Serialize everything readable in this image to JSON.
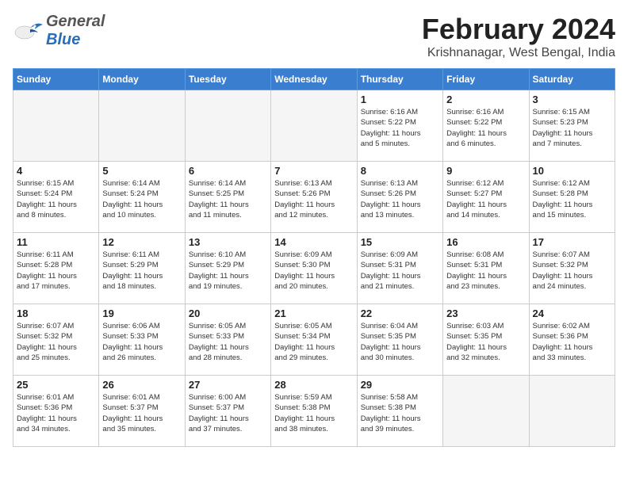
{
  "header": {
    "logo_general": "General",
    "logo_blue": "Blue",
    "month_title": "February 2024",
    "location": "Krishnanagar, West Bengal, India"
  },
  "weekdays": [
    "Sunday",
    "Monday",
    "Tuesday",
    "Wednesday",
    "Thursday",
    "Friday",
    "Saturday"
  ],
  "weeks": [
    [
      {
        "day": "",
        "info": ""
      },
      {
        "day": "",
        "info": ""
      },
      {
        "day": "",
        "info": ""
      },
      {
        "day": "",
        "info": ""
      },
      {
        "day": "1",
        "info": "Sunrise: 6:16 AM\nSunset: 5:22 PM\nDaylight: 11 hours\nand 5 minutes."
      },
      {
        "day": "2",
        "info": "Sunrise: 6:16 AM\nSunset: 5:22 PM\nDaylight: 11 hours\nand 6 minutes."
      },
      {
        "day": "3",
        "info": "Sunrise: 6:15 AM\nSunset: 5:23 PM\nDaylight: 11 hours\nand 7 minutes."
      }
    ],
    [
      {
        "day": "4",
        "info": "Sunrise: 6:15 AM\nSunset: 5:24 PM\nDaylight: 11 hours\nand 8 minutes."
      },
      {
        "day": "5",
        "info": "Sunrise: 6:14 AM\nSunset: 5:24 PM\nDaylight: 11 hours\nand 10 minutes."
      },
      {
        "day": "6",
        "info": "Sunrise: 6:14 AM\nSunset: 5:25 PM\nDaylight: 11 hours\nand 11 minutes."
      },
      {
        "day": "7",
        "info": "Sunrise: 6:13 AM\nSunset: 5:26 PM\nDaylight: 11 hours\nand 12 minutes."
      },
      {
        "day": "8",
        "info": "Sunrise: 6:13 AM\nSunset: 5:26 PM\nDaylight: 11 hours\nand 13 minutes."
      },
      {
        "day": "9",
        "info": "Sunrise: 6:12 AM\nSunset: 5:27 PM\nDaylight: 11 hours\nand 14 minutes."
      },
      {
        "day": "10",
        "info": "Sunrise: 6:12 AM\nSunset: 5:28 PM\nDaylight: 11 hours\nand 15 minutes."
      }
    ],
    [
      {
        "day": "11",
        "info": "Sunrise: 6:11 AM\nSunset: 5:28 PM\nDaylight: 11 hours\nand 17 minutes."
      },
      {
        "day": "12",
        "info": "Sunrise: 6:11 AM\nSunset: 5:29 PM\nDaylight: 11 hours\nand 18 minutes."
      },
      {
        "day": "13",
        "info": "Sunrise: 6:10 AM\nSunset: 5:29 PM\nDaylight: 11 hours\nand 19 minutes."
      },
      {
        "day": "14",
        "info": "Sunrise: 6:09 AM\nSunset: 5:30 PM\nDaylight: 11 hours\nand 20 minutes."
      },
      {
        "day": "15",
        "info": "Sunrise: 6:09 AM\nSunset: 5:31 PM\nDaylight: 11 hours\nand 21 minutes."
      },
      {
        "day": "16",
        "info": "Sunrise: 6:08 AM\nSunset: 5:31 PM\nDaylight: 11 hours\nand 23 minutes."
      },
      {
        "day": "17",
        "info": "Sunrise: 6:07 AM\nSunset: 5:32 PM\nDaylight: 11 hours\nand 24 minutes."
      }
    ],
    [
      {
        "day": "18",
        "info": "Sunrise: 6:07 AM\nSunset: 5:32 PM\nDaylight: 11 hours\nand 25 minutes."
      },
      {
        "day": "19",
        "info": "Sunrise: 6:06 AM\nSunset: 5:33 PM\nDaylight: 11 hours\nand 26 minutes."
      },
      {
        "day": "20",
        "info": "Sunrise: 6:05 AM\nSunset: 5:33 PM\nDaylight: 11 hours\nand 28 minutes."
      },
      {
        "day": "21",
        "info": "Sunrise: 6:05 AM\nSunset: 5:34 PM\nDaylight: 11 hours\nand 29 minutes."
      },
      {
        "day": "22",
        "info": "Sunrise: 6:04 AM\nSunset: 5:35 PM\nDaylight: 11 hours\nand 30 minutes."
      },
      {
        "day": "23",
        "info": "Sunrise: 6:03 AM\nSunset: 5:35 PM\nDaylight: 11 hours\nand 32 minutes."
      },
      {
        "day": "24",
        "info": "Sunrise: 6:02 AM\nSunset: 5:36 PM\nDaylight: 11 hours\nand 33 minutes."
      }
    ],
    [
      {
        "day": "25",
        "info": "Sunrise: 6:01 AM\nSunset: 5:36 PM\nDaylight: 11 hours\nand 34 minutes."
      },
      {
        "day": "26",
        "info": "Sunrise: 6:01 AM\nSunset: 5:37 PM\nDaylight: 11 hours\nand 35 minutes."
      },
      {
        "day": "27",
        "info": "Sunrise: 6:00 AM\nSunset: 5:37 PM\nDaylight: 11 hours\nand 37 minutes."
      },
      {
        "day": "28",
        "info": "Sunrise: 5:59 AM\nSunset: 5:38 PM\nDaylight: 11 hours\nand 38 minutes."
      },
      {
        "day": "29",
        "info": "Sunrise: 5:58 AM\nSunset: 5:38 PM\nDaylight: 11 hours\nand 39 minutes."
      },
      {
        "day": "",
        "info": ""
      },
      {
        "day": "",
        "info": ""
      }
    ]
  ]
}
